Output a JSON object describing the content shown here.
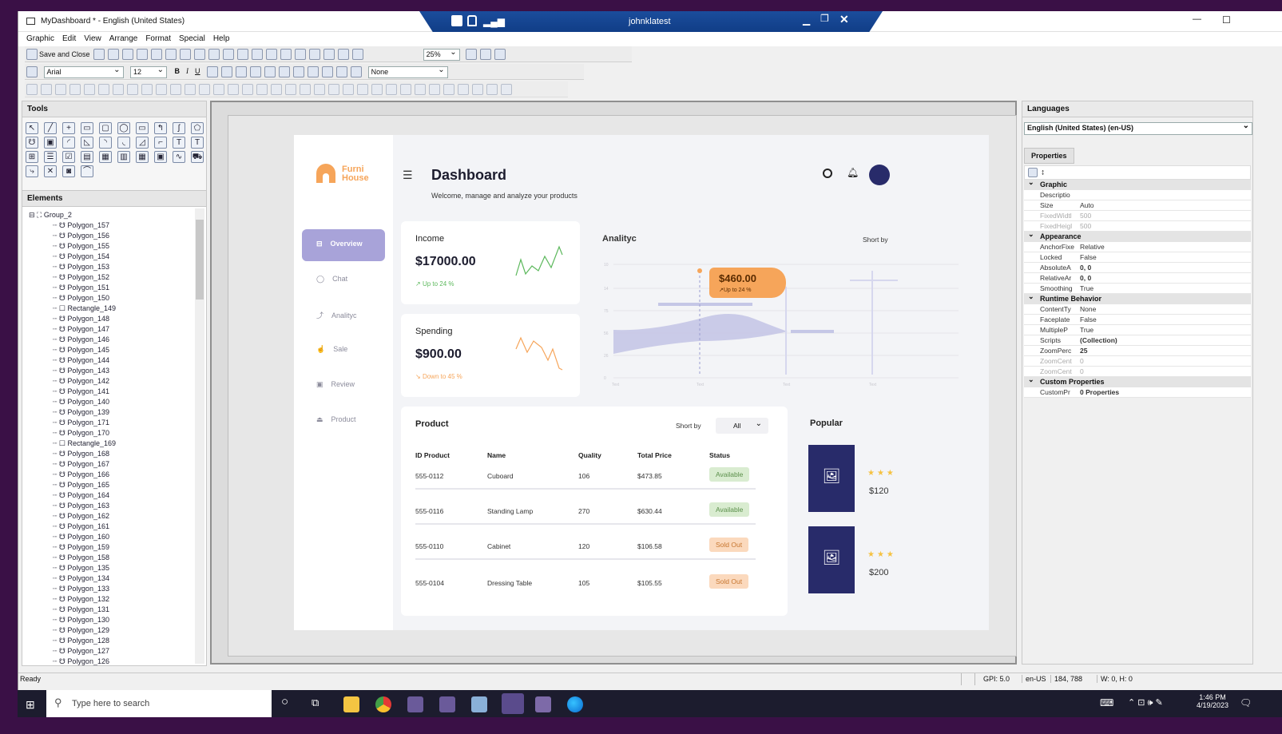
{
  "window": {
    "title": "MyDashboard * - English (United States)",
    "remote_user": "johnklatest",
    "minimize": "—",
    "maximize": "☐"
  },
  "menu": [
    "Graphic",
    "Edit",
    "View",
    "Arrange",
    "Format",
    "Special",
    "Help"
  ],
  "toolbar": {
    "save_close": "Save and Close",
    "zoom": "25%",
    "font": "Arial",
    "font_size": "12",
    "bold": "B",
    "italic": "I",
    "underline": "U",
    "line_style": "None"
  },
  "tools_panel": {
    "title": "Tools"
  },
  "elements_panel": {
    "title": "Elements",
    "group": "Group_2",
    "items": [
      "Polygon_157",
      "Polygon_156",
      "Polygon_155",
      "Polygon_154",
      "Polygon_153",
      "Polygon_152",
      "Polygon_151",
      "Polygon_150",
      "Rectangle_149",
      "Polygon_148",
      "Polygon_147",
      "Polygon_146",
      "Polygon_145",
      "Polygon_144",
      "Polygon_143",
      "Polygon_142",
      "Polygon_141",
      "Polygon_140",
      "Polygon_139",
      "Polygon_171",
      "Polygon_170",
      "Rectangle_169",
      "Polygon_168",
      "Polygon_167",
      "Polygon_166",
      "Polygon_165",
      "Polygon_164",
      "Polygon_163",
      "Polygon_162",
      "Polygon_161",
      "Polygon_160",
      "Polygon_159",
      "Polygon_158",
      "Polygon_135",
      "Polygon_134",
      "Polygon_133",
      "Polygon_132",
      "Polygon_131",
      "Polygon_130",
      "Polygon_129",
      "Polygon_128",
      "Polygon_127",
      "Polygon_126"
    ]
  },
  "dashboard": {
    "brand_line1": "Furni",
    "brand_line2": "House",
    "title": "Dashboard",
    "subtitle": "Welcome, manage and analyze your products",
    "nav": [
      "Overview",
      "Chat",
      "Analityc",
      "Sale",
      "Review",
      "Product"
    ],
    "income": {
      "label": "Income",
      "value": "$17000.00",
      "trend": "Up to 24 %"
    },
    "spending": {
      "label": "Spending",
      "value": "$900.00",
      "trend": "Down to 45 %"
    },
    "analytics": {
      "title": "Analityc",
      "sort": "Short by",
      "tooltip_value": "$460.00",
      "tooltip_trend": "Up to 24 %"
    },
    "product": {
      "title": "Product",
      "sort_label": "Short by",
      "sort_value": "All",
      "columns": [
        "ID Product",
        "Name",
        "Quality",
        "Total Price",
        "Status"
      ],
      "rows": [
        {
          "id": "555-0112",
          "name": "Cuboard",
          "quality": "106",
          "price": "$473.85",
          "status": "Available"
        },
        {
          "id": "555-0116",
          "name": "Standing Lamp",
          "quality": "270",
          "price": "$630.44",
          "status": "Available"
        },
        {
          "id": "555-0110",
          "name": "Cabinet",
          "quality": "120",
          "price": "$106.58",
          "status": "Sold Out"
        },
        {
          "id": "555-0104",
          "name": "Dressing Table",
          "quality": "105",
          "price": "$105.55",
          "status": "Sold Out"
        }
      ]
    },
    "popular": {
      "title": "Popular",
      "items": [
        {
          "price": "$120"
        },
        {
          "price": "$200"
        }
      ]
    },
    "colors": {
      "accent": "#a8a3d9",
      "navy": "#282b6a",
      "orange": "#f6a55a",
      "available_bg": "#d9ecd0",
      "soldout_bg": "#fbd9bd"
    }
  },
  "properties_panel": {
    "languages_title": "Languages",
    "language": "English (United States) (en-US)",
    "properties_tab": "Properties",
    "categories": [
      {
        "name": "Graphic",
        "rows": [
          {
            "k": "Descriptio",
            "v": "",
            "grey": false
          },
          {
            "k": "Size",
            "v": "Auto",
            "grey": false
          },
          {
            "k": "FixedWidtl",
            "v": "500",
            "grey": true
          },
          {
            "k": "FixedHeigl",
            "v": "500",
            "grey": true
          }
        ]
      },
      {
        "name": "Appearance",
        "rows": [
          {
            "k": "AnchorFixe",
            "v": "Relative",
            "grey": false
          },
          {
            "k": "Locked",
            "v": "False",
            "grey": false
          },
          {
            "k": "AbsoluteA",
            "v": "0, 0",
            "grey": false
          },
          {
            "k": "RelativeAr",
            "v": "0, 0",
            "grey": false
          },
          {
            "k": "Smoothing",
            "v": "True",
            "grey": false
          }
        ]
      },
      {
        "name": "Runtime Behavior",
        "rows": [
          {
            "k": "ContentTy",
            "v": "None",
            "grey": false
          },
          {
            "k": "Faceplate",
            "v": "False",
            "grey": false
          },
          {
            "k": "MultipleP",
            "v": "True",
            "grey": false
          },
          {
            "k": "Scripts",
            "v": "(Collection)",
            "grey": false
          },
          {
            "k": "ZoomPerc",
            "v": "25",
            "grey": false
          },
          {
            "k": "ZoomCent",
            "v": "0",
            "grey": true
          },
          {
            "k": "ZoomCent",
            "v": "0",
            "grey": true
          }
        ]
      },
      {
        "name": "Custom Properties",
        "rows": [
          {
            "k": "CustomPr",
            "v": "0 Properties",
            "grey": false
          }
        ]
      }
    ]
  },
  "statusbar": {
    "status": "Ready",
    "gpi": "GPI: 5.0",
    "locale": "en-US",
    "coords": "184, 788",
    "size": "W: 0, H: 0"
  },
  "taskbar": {
    "search_placeholder": "Type here to search",
    "time": "1:46 PM",
    "date": "4/19/2023"
  }
}
